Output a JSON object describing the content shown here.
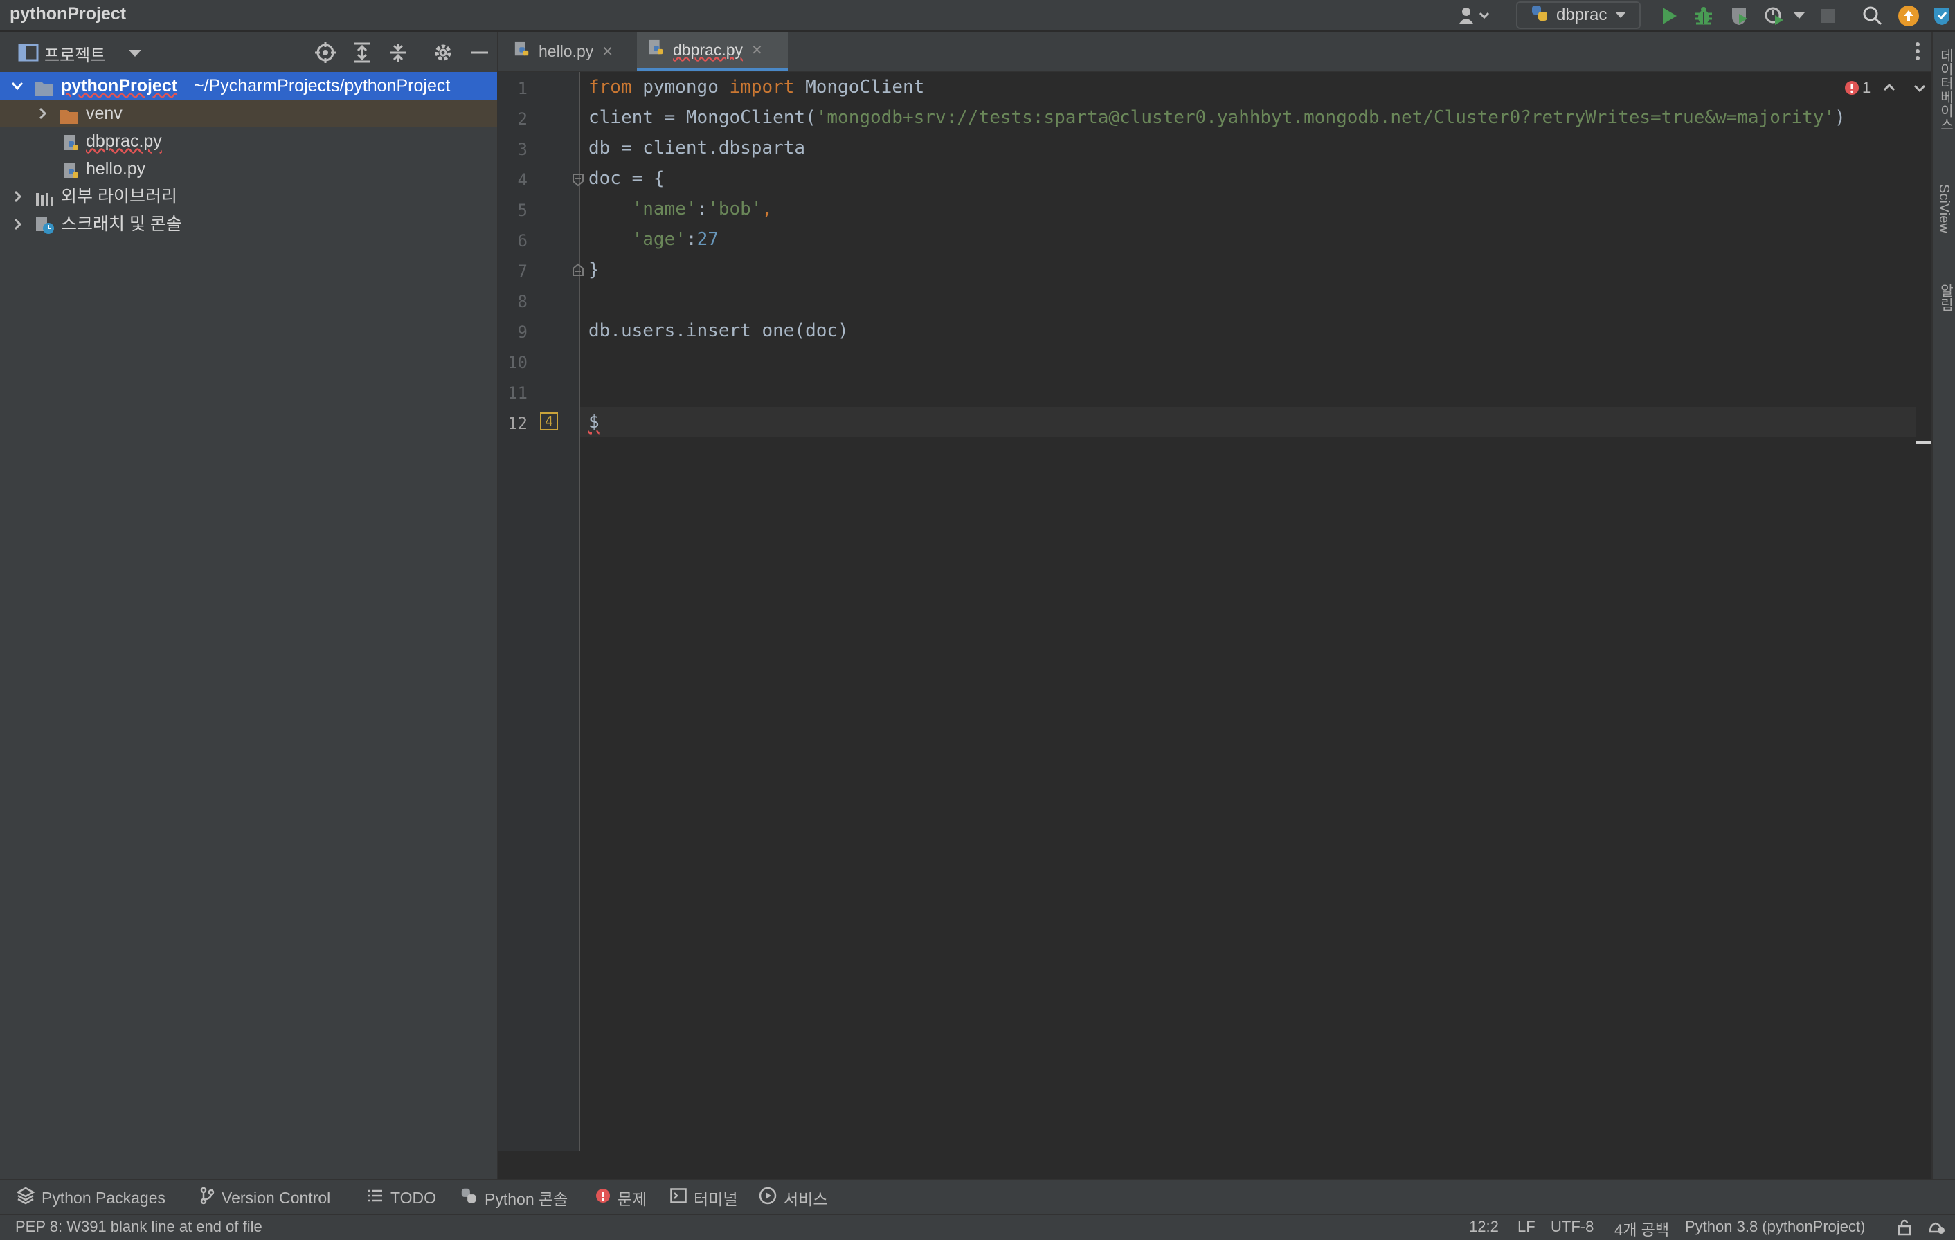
{
  "app": {
    "title": "pythonProject"
  },
  "toolbar": {
    "run_config": "dbprac",
    "icons": [
      "user-icon",
      "python-icon",
      "run-icon",
      "debug-icon",
      "coverage-icon",
      "profile-icon",
      "stop-icon",
      "search-icon",
      "update-icon"
    ]
  },
  "project_panel": {
    "title": "프로젝트",
    "tree": {
      "root_name": "pythonProject",
      "root_path": "~/PycharmProjects/pythonProject",
      "venv": "venv",
      "file1": "dbprac.py",
      "file2": "hello.py",
      "external_libs": "외부 라이브러리",
      "scratches": "스크래치 및 콘솔"
    }
  },
  "tabs": [
    {
      "label": "hello.py",
      "active": false
    },
    {
      "label": "dbprac.py",
      "active": true
    }
  ],
  "editor": {
    "line_numbers": [
      "1",
      "2",
      "3",
      "4",
      "5",
      "6",
      "7",
      "8",
      "9",
      "10",
      "11",
      "12"
    ],
    "lines": {
      "l1_a": "from",
      "l1_b": " pymongo ",
      "l1_c": "import",
      "l1_d": " MongoClient",
      "l2_a": "client = MongoClient(",
      "l2_b": "'mongodb+srv://tests:sparta@cluster0.yahhbyt.mongodb.net/Cluster0?retryWrites=true&w=majority'",
      "l2_c": ")",
      "l3": "db = client.dbsparta",
      "l4": "doc = {",
      "l5_a": "    ",
      "l5_b": "'name'",
      "l5_c": ":",
      "l5_d": "'bob'",
      "l5_e": ",",
      "l6_a": "    ",
      "l6_b": "'age'",
      "l6_c": ":",
      "l6_d": "27",
      "l7": "}",
      "l9": "db.users.insert_one(doc)",
      "l12": "$"
    },
    "gutter_badge": "4",
    "error_count": "1"
  },
  "tool_windows": [
    {
      "label": "Python Packages",
      "icon": "layers-icon"
    },
    {
      "label": "Version Control",
      "icon": "branch-icon"
    },
    {
      "label": "TODO",
      "icon": "list-icon"
    },
    {
      "label": "Python 콘솔",
      "icon": "python-icon"
    },
    {
      "label": "문제",
      "icon": "error-icon"
    },
    {
      "label": "터미널",
      "icon": "terminal-icon"
    },
    {
      "label": "서비스",
      "icon": "services-icon"
    }
  ],
  "status_bar": {
    "message": "PEP 8: W391 blank line at end of file",
    "position": "12:2",
    "line_sep": "LF",
    "encoding": "UTF-8",
    "indent": "4개 공백",
    "interpreter": "Python 3.8 (pythonProject)"
  },
  "right_strip": {
    "label1": "데이터베이스",
    "label2": "SciView",
    "label3": "알림"
  },
  "colors": {
    "accent": "#2f65ca",
    "keyword": "#cc7832",
    "string": "#6a8759",
    "number": "#6897bb",
    "error": "#e05555"
  }
}
